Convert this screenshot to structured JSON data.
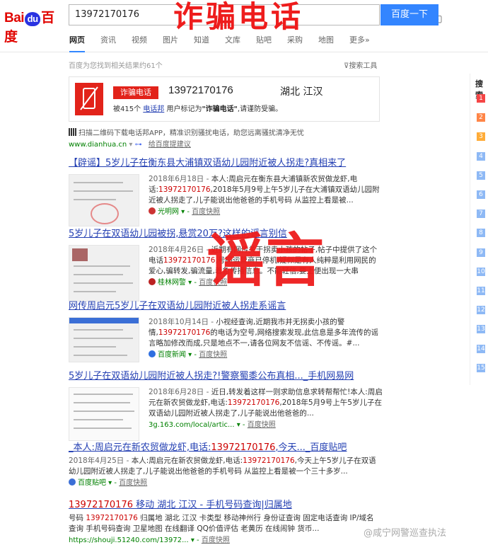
{
  "header": {
    "logo_bai": "Bai",
    "logo_du": "du",
    "logo_cn": "百度",
    "search_value": "13972170176",
    "search_button": "百度一下",
    "tabs": [
      "网页",
      "资讯",
      "视频",
      "图片",
      "知道",
      "文库",
      "贴吧",
      "采购",
      "地图",
      "更多»"
    ]
  },
  "stamps": {
    "top": "诈骗电话",
    "middle": "谣言"
  },
  "result_count": "百度为您找到相关结果约61个",
  "search_tools": "搜索工具",
  "fraud_card": {
    "badge": "诈骗电话",
    "number": "13972170176",
    "location": "湖北  江汉",
    "desc_pre": "被415个",
    "desc_link": "电话邦",
    "desc_mid": "用户标记为",
    "desc_bold": "\"诈骗电话\"",
    "desc_post": ",请谨防受骗。"
  },
  "qr_line": "扫描二维码下载电话邦APP，精准识别骚扰电话，助您远离骚扰清净无忧",
  "dianhua": {
    "url": "www.dianhua.cn",
    "feedback": "给百度提建议"
  },
  "results": [
    {
      "title": "【辟谣】5岁儿子在衡东县大浦镇双语幼儿园附近被人拐走?真相来了",
      "date": "2018年6月18日 - ",
      "body_a": "本人:周启元在衡东县大浦镇新农贸做龙虾,电话:",
      "phone": "13972170176",
      "body_b": ",2018年5月9号上午5岁儿子在大浦镇双语幼儿园附近被人拐走了,儿子能说出他爸爸的手机号码 从监控上看是被...",
      "source": "光明网",
      "snapshot": "百度快照"
    },
    {
      "title": "5岁儿子在双语幼儿园被拐,悬赏20万?这样的谣言别信",
      "date": "2018年4月26日 - ",
      "body_a": "近期有网传关于拐卖小孩的帖子,帖子中提供了这个电话",
      "phone": "13972170176",
      "body_b": ",号码运营商已停机,疑似是有人纯粹是利用网民的爱心,骗转发,骗流量,着急传播信息。不能轻信,要上便出现一大串",
      "source": "桂林网警",
      "snapshot": "百度快照"
    },
    {
      "title": "网传周启元5岁儿子在双语幼儿园附近被人拐走系谣言",
      "date": "2018年10月14日 - ",
      "body_a": "小视经查询,近期我市并无拐卖小孩的警情,",
      "phone": "13972170176",
      "body_b": "的电话为空号,网络搜索发现,此信息是多年流传的谣言略加修改而成,只是地点不一,请各位网友不信谣、不传谣。#...",
      "source": "百度新闻",
      "snapshot": "百度快照"
    },
    {
      "title": "5岁儿子在双语幼儿园附近被人拐走?!警察蜀黍公布真相..._手机网易网",
      "date": "2018年6月28日 - ",
      "body_a": "近日,转发着这样一则求助信息求转帮帮忙!本人:周启元在新农贸做龙虾,电话:",
      "phone": "13972170176",
      "body_b": ",2018年5月9号上午5岁儿子在双语幼儿园附近被人拐走了,儿子能说出他爸爸的...",
      "source": "3g.163.com/local/artic...",
      "snapshot": "百度快照"
    },
    {
      "title_a": "_本人:周启元在新农贸做龙虾,电话:",
      "title_phone": "13972170176",
      "title_b": ",今天..._百度贴吧",
      "date": "2018年4月25日 - ",
      "body_a": "本人:周启元在新农贸做龙虾,电话:",
      "phone": "13972170176",
      "body_b": ",今天上午5岁儿子在双语幼儿园附近被人拐走了,儿子能说出他爸爸的手机号码 从监控上看是被一个三十多岁...",
      "source": "百度贴吧",
      "snapshot": "百度快照"
    },
    {
      "title_phone": "13972170176",
      "title_b": " 移动 湖北 江汉 - 手机号码查询|归属地",
      "body_a": "号码 ",
      "phone": "13972170176",
      "body_b": " 归属地 湖北 江汉 卡类型 移动神州行 身份证查询 固定电话查询 IP/域名查询 手机号码查询 卫星地图 在线翻译 QQ价值评估 老黄历 在线闹钟 货币...",
      "source": "https://shouji.51240.com/13972...",
      "snapshot": "百度快照"
    }
  ],
  "right": {
    "label": "搜索",
    "ranks": [
      "1",
      "2",
      "3",
      "4",
      "5",
      "6",
      "7",
      "8",
      "9",
      "10",
      "11",
      "12",
      "13",
      "14",
      "15"
    ]
  },
  "watermark": "@咸宁网警巡查执法",
  "colors": {
    "accent": "#3385ff",
    "fraud": "#e2231a",
    "link": "#2440b3",
    "url": "#008000",
    "stamp": "#ee1c1c"
  }
}
